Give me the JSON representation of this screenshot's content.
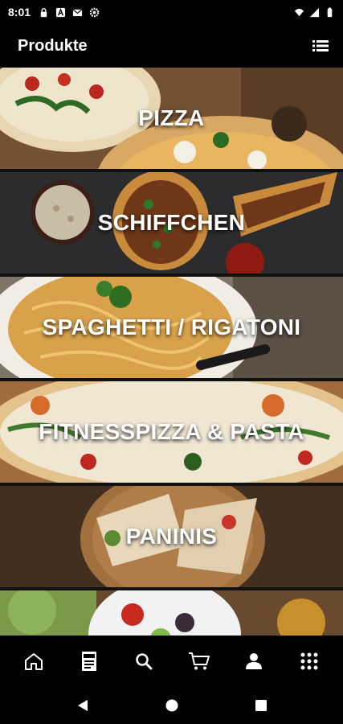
{
  "status_bar": {
    "time": "8:01",
    "icons_left": [
      "lock-icon",
      "a-icon",
      "mail-icon",
      "settings-icon"
    ],
    "icons_right": [
      "wifi-icon",
      "signal-icon",
      "battery-icon"
    ]
  },
  "app_bar": {
    "title": "Produkte",
    "action_icon": "list-icon"
  },
  "categories": [
    {
      "label": "PIZZA"
    },
    {
      "label": "SCHIFFCHEN"
    },
    {
      "label": "SPAGHETTI / RIGATONI"
    },
    {
      "label": "FITNESSPIZZA & PASTA"
    },
    {
      "label": "PANINIS"
    },
    {
      "label": ""
    }
  ],
  "bottom_nav": [
    "home-icon",
    "menu-pdf-icon",
    "search-icon",
    "cart-icon",
    "user-icon",
    "apps-grid-icon"
  ],
  "system_nav": [
    "back-icon",
    "home-circle-icon",
    "recents-icon"
  ],
  "colors": {
    "background": "#000000",
    "text": "#ffffff"
  }
}
